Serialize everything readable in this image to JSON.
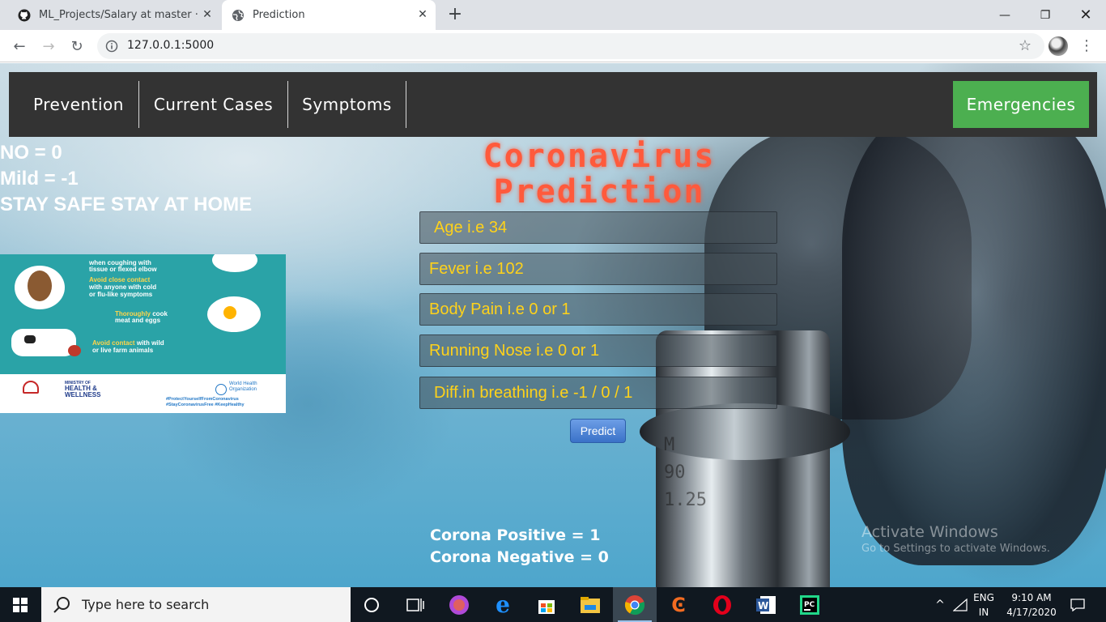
{
  "browser": {
    "tabs": [
      {
        "title": "ML_Projects/Salary at master · vis",
        "icon": "github-icon"
      },
      {
        "title": "Prediction",
        "icon": "globe-icon"
      }
    ],
    "url": "127.0.0.1:5000"
  },
  "navbar": {
    "items": [
      "Prevention",
      "Current Cases",
      "Symptoms"
    ],
    "emergency": "Emergencies"
  },
  "legend": {
    "line1": "NO = 0",
    "line2": "Mild = -1",
    "line3": "STAY SAFE STAY AT HOME"
  },
  "poster": {
    "r1": "when coughing with",
    "r2": "tissue or flexed elbow",
    "r3a": "Avoid close contact",
    "r3b": "with anyone with cold",
    "r3c": "or flu-like symptoms",
    "r4a": "Thoroughly",
    "r4b": "cook",
    "r4c": "meat and eggs",
    "r5a": "Avoid contact",
    "r5b": "with wild",
    "r5c": "or live farm animals",
    "ministry": "MINISTRY OF",
    "health": "HEALTH &",
    "wellness": "WELLNESS",
    "who1": "World Health",
    "who2": "Organization",
    "tag1": "#ProtectYourselfFromCoronavirus",
    "tag2": "#StayCoronavirusFree #KeepHealthy"
  },
  "heading": {
    "line1": "Coronavirus",
    "line2": "Prediction"
  },
  "form": {
    "age_placeholder": "Age i.e 34",
    "fever_placeholder": "Fever i.e 102",
    "bodypain_placeholder": "Body Pain i.e 0 or 1",
    "runnynose_placeholder": "Running Nose i.e 0 or 1",
    "breathing_placeholder": "Diff.in breathing i.e -1 / 0 / 1",
    "predict_label": "Predict"
  },
  "results": {
    "positive": "Corona Positive = 1",
    "negative": "Corona Negative = 0"
  },
  "watermark": {
    "title": "Activate Windows",
    "subtitle": "Go to Settings to activate Windows."
  },
  "taskbar": {
    "search_placeholder": "Type here to search",
    "lang1": "ENG",
    "lang2": "IN",
    "time": "9:10 AM",
    "date": "4/17/2020"
  },
  "colors": {
    "heading": "#ff5a3c",
    "field_text": "#ffd21a",
    "emergency": "#4caf50",
    "navbar": "#333333"
  }
}
